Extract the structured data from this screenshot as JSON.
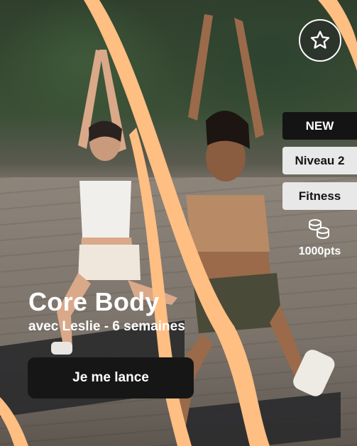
{
  "program": {
    "title": "Core Body",
    "subtitle": "avec Leslie - 6 semaines",
    "cta_label": "Je me lance"
  },
  "badges": {
    "new": "NEW",
    "level": "Niveau 2",
    "category": "Fitness"
  },
  "reward": {
    "points": "1000pts",
    "icon": "coins-icon"
  },
  "favorite": {
    "icon": "star-icon"
  },
  "colors": {
    "accent": "#FFBE82",
    "dark": "#161616",
    "light_tag": "#E8E8E8"
  }
}
